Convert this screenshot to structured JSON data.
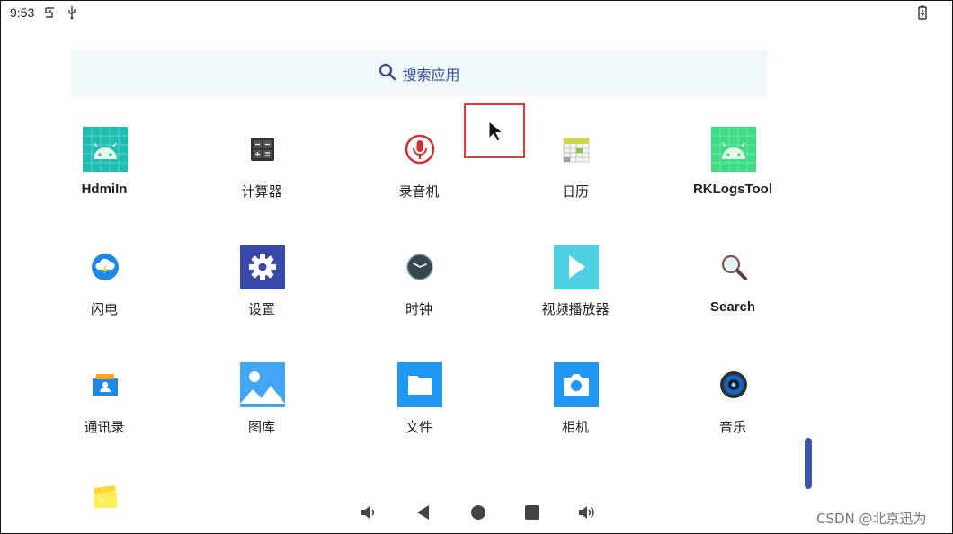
{
  "status_bar": {
    "time": "9:53",
    "icons": [
      "notification-icon",
      "usb-icon",
      "battery-charging-icon"
    ]
  },
  "search": {
    "label": "搜索应用",
    "icon": "search-icon"
  },
  "apps": [
    {
      "label": "HdmiIn",
      "icon": "android-app-icon"
    },
    {
      "label": "计算器",
      "icon": "calculator-icon"
    },
    {
      "label": "录音机",
      "icon": "microphone-icon"
    },
    {
      "label": "日历",
      "icon": "calendar-icon"
    },
    {
      "label": "RKLogsTool",
      "icon": "android-app-icon"
    },
    {
      "label": "闪电",
      "icon": "lightning-cloud-icon"
    },
    {
      "label": "设置",
      "icon": "gear-icon"
    },
    {
      "label": "时钟",
      "icon": "clock-icon"
    },
    {
      "label": "视频播放器",
      "icon": "play-icon"
    },
    {
      "label": "Search",
      "icon": "magnifier-icon"
    },
    {
      "label": "通讯录",
      "icon": "contacts-icon"
    },
    {
      "label": "图库",
      "icon": "gallery-icon"
    },
    {
      "label": "文件",
      "icon": "folder-icon"
    },
    {
      "label": "相机",
      "icon": "camera-icon"
    },
    {
      "label": "音乐",
      "icon": "speaker-icon"
    }
  ],
  "nav_bar": [
    "volume-down-icon",
    "back-icon",
    "home-icon",
    "recents-icon",
    "volume-up-icon"
  ],
  "watermark": "CSDN @北京迅为",
  "colors": {
    "accent": "#2f4a9e",
    "search_bg": "#f0f8fb",
    "highlight": "#e53935",
    "scroll": "#3a55b0"
  }
}
